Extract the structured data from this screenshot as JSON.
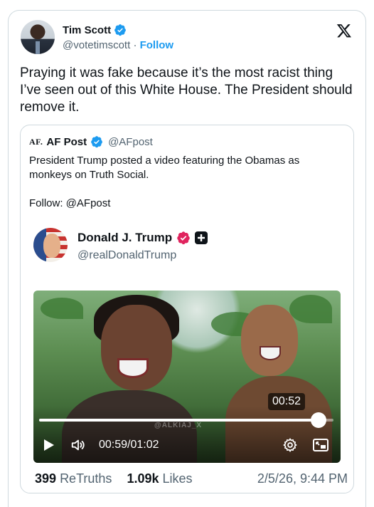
{
  "tweet": {
    "author_name": "Tim Scott",
    "handle": "@votetimscott",
    "separator": "·",
    "follow_label": "Follow",
    "text": "Praying it was fake because it’s the most racist thing I’ve seen out of this White House. The President should remove it."
  },
  "quote": {
    "logo_text": "AF.",
    "author_name": "AF Post",
    "handle": "@AFpost",
    "line1": "President Trump posted a video featuring the Obamas as monkeys on Truth Social.",
    "line2": "Follow: @AFpost"
  },
  "embedded_post": {
    "author_name": "Donald J. Trump",
    "handle": "@realDonaldTrump"
  },
  "video": {
    "hover_time": "00:52",
    "watermark": "@ALKIAJ_X",
    "current_time": "00:59",
    "separator": "/",
    "duration": "01:02",
    "progress_fraction": 0.95
  },
  "stats": {
    "retruths_count": "399",
    "retruths_label": "ReTruths",
    "likes_count": "1.09k",
    "likes_label": "Likes",
    "date": "2/5/26, 9:44 PM"
  },
  "colors": {
    "accent": "#1d9bf0",
    "muted": "#536471",
    "trump_badge": "#e0245e"
  }
}
